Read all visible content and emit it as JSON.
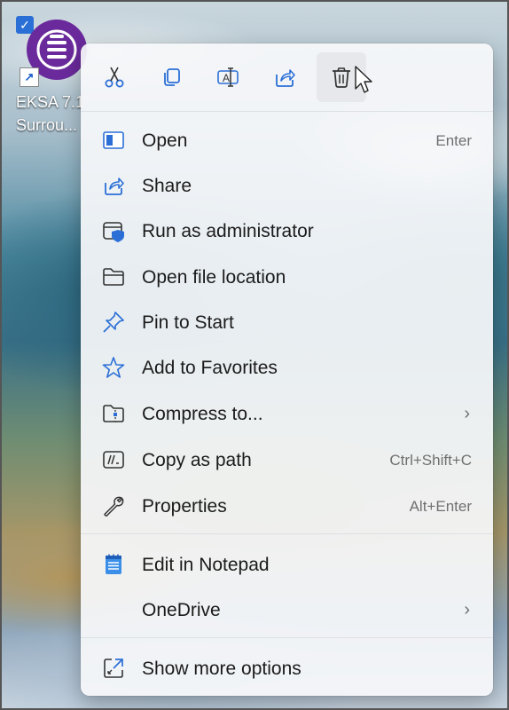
{
  "desktop": {
    "icon_label_line1": "EKSA 7.1",
    "icon_label_line2": "Surrou..."
  },
  "quick_actions": [
    {
      "name": "cut",
      "icon": "scissors-icon"
    },
    {
      "name": "copy",
      "icon": "copy-icon"
    },
    {
      "name": "rename",
      "icon": "rename-icon"
    },
    {
      "name": "share",
      "icon": "share-icon"
    },
    {
      "name": "delete",
      "icon": "trash-icon"
    }
  ],
  "menu": {
    "items": [
      {
        "label": "Open",
        "shortcut": "Enter",
        "icon": "open-window-icon"
      },
      {
        "label": "Share",
        "shortcut": "",
        "icon": "share-icon"
      },
      {
        "label": "Run as administrator",
        "shortcut": "",
        "icon": "admin-shield-icon"
      },
      {
        "label": "Open file location",
        "shortcut": "",
        "icon": "folder-icon"
      },
      {
        "label": "Pin to Start",
        "shortcut": "",
        "icon": "pin-icon"
      },
      {
        "label": "Add to Favorites",
        "shortcut": "",
        "icon": "star-icon"
      },
      {
        "label": "Compress to...",
        "shortcut": "",
        "icon": "zip-folder-icon",
        "submenu": true
      },
      {
        "label": "Copy as path",
        "shortcut": "Ctrl+Shift+C",
        "icon": "path-icon"
      },
      {
        "label": "Properties",
        "shortcut": "Alt+Enter",
        "icon": "wrench-icon"
      },
      {
        "label": "Edit in Notepad",
        "shortcut": "",
        "icon": "notepad-icon"
      },
      {
        "label": "OneDrive",
        "shortcut": "",
        "icon": "",
        "submenu": true
      },
      {
        "label": "Show more options",
        "shortcut": "",
        "icon": "expand-icon"
      }
    ],
    "submenu_glyph": "›"
  },
  "colors": {
    "icon_blue": "#2b6fd6",
    "text": "#1b1b1b",
    "shortcut_text": "#6f6f6f",
    "app_purple": "#6b2a9c"
  }
}
